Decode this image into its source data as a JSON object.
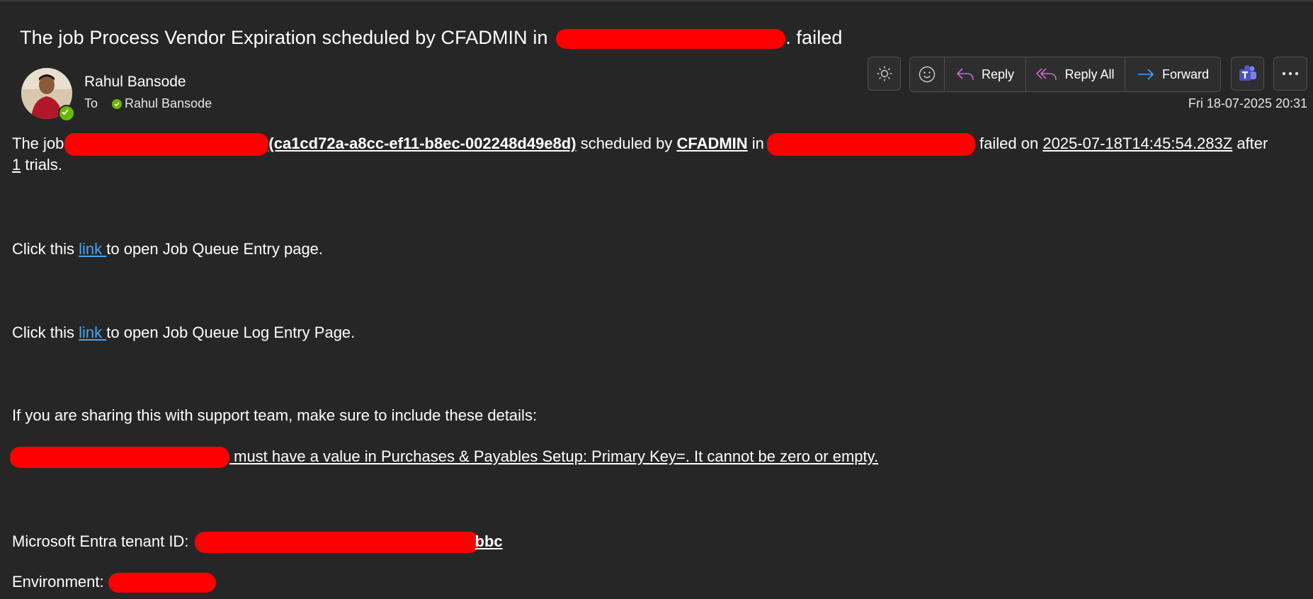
{
  "email": {
    "subject_prefix": "The job Process Vendor Expiration scheduled by CFADMIN in",
    "subject_suffix": ". failed",
    "sender_name": "Rahul Bansode",
    "to_label": "To",
    "recipient": "Rahul Bansode",
    "date": "Fri 18-07-2025 20:31"
  },
  "toolbar": {
    "reply": "Reply",
    "reply_all": "Reply All",
    "forward": "Forward"
  },
  "body": {
    "p1_a": "The job",
    "p1_id": "(ca1cd72a-a8cc-ef11-b8ec-002248d49e8d)",
    "p1_b": " scheduled by ",
    "p1_user": "CFADMIN",
    "p1_c": " in",
    "p1_d": " failed on ",
    "p1_timestamp": "2025-07-18T14:45:54.283Z",
    "p1_e": " after",
    "p1_trials_count": "1",
    "p1_f": " trials.",
    "p2_a": "Click this ",
    "p2_link": "link ",
    "p2_b": "to open Job Queue Entry page.",
    "p3_a": "Click this ",
    "p3_link": "link ",
    "p3_b": "to open Job Queue Log Entry Page.",
    "p4": "If you are sharing this with support team, make sure to include these details:",
    "p5": " must have a value in Purchases & Payables Setup: Primary Key=. It cannot be zero or empty.",
    "p6_label": "Microsoft Entra tenant ID: ",
    "p6_value_tail": "bbc",
    "p7_label": "Environment: "
  },
  "colors": {
    "background": "#262626",
    "link": "#4aa3f0",
    "redaction": "#ff0000",
    "presence": "#6bb700",
    "reply_icon": "#c96bd1",
    "forward_icon": "#4aa3f0"
  }
}
